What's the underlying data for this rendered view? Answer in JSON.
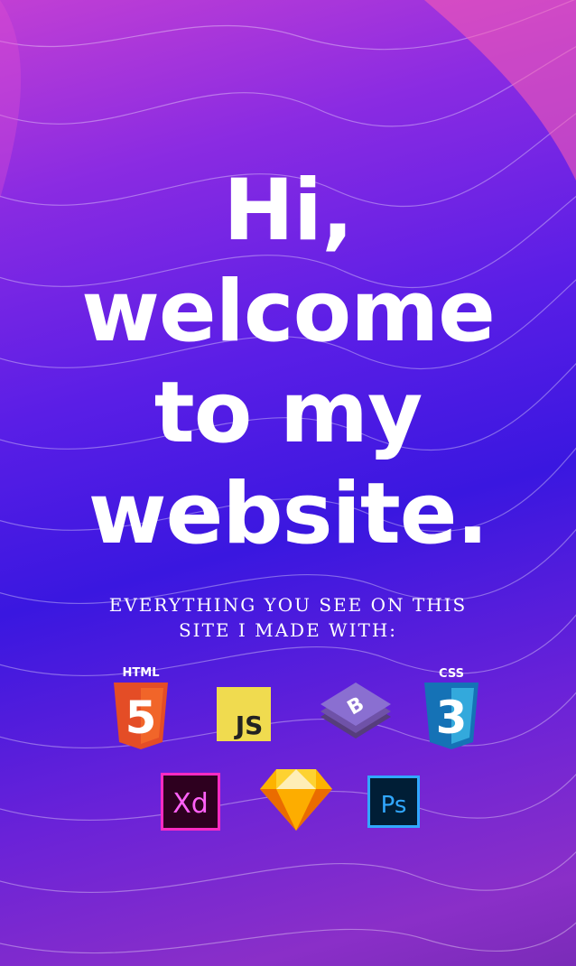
{
  "hero": {
    "line1": "Hi,",
    "line2": "welcome",
    "line3": "to my",
    "line4": "website."
  },
  "subtitle": {
    "line1": "EVERYTHING YOU SEE ON THIS",
    "line2": "SITE I MADE WITH:"
  },
  "tools": [
    {
      "name": "html5-icon",
      "label": "HTML",
      "glyph": "5",
      "color": "#e44d26"
    },
    {
      "name": "javascript-icon",
      "label": "JS",
      "color": "#f0db4f"
    },
    {
      "name": "bootstrap-icon",
      "glyph": "B",
      "color": "#7952b3"
    },
    {
      "name": "css3-icon",
      "label": "CSS",
      "glyph": "3",
      "color": "#1572b6"
    },
    {
      "name": "adobe-xd-icon",
      "label": "Xd",
      "color": "#ff2bc2"
    },
    {
      "name": "sketch-icon",
      "color": "#fdb300"
    },
    {
      "name": "photoshop-icon",
      "label": "Ps",
      "color": "#31a8ff"
    }
  ]
}
